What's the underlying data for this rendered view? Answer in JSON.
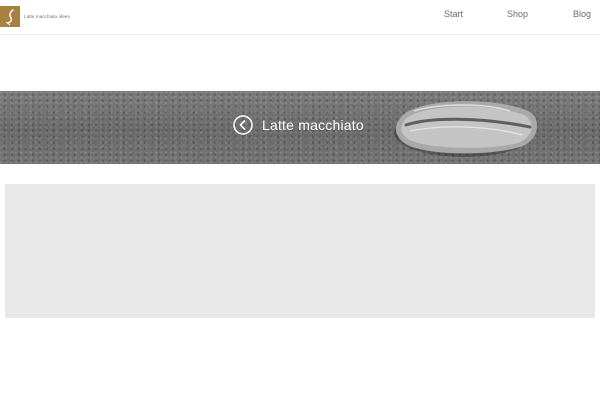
{
  "header": {
    "logo_text": "Latte macchiato ideen"
  },
  "nav": {
    "items": [
      "Start",
      "Shop",
      "Blog"
    ]
  },
  "banner": {
    "title": "Latte macchiato"
  },
  "colors": {
    "brand": "#a8813f",
    "nav_text": "#6c6c6c",
    "content_placeholder": "#e8e8e8"
  }
}
